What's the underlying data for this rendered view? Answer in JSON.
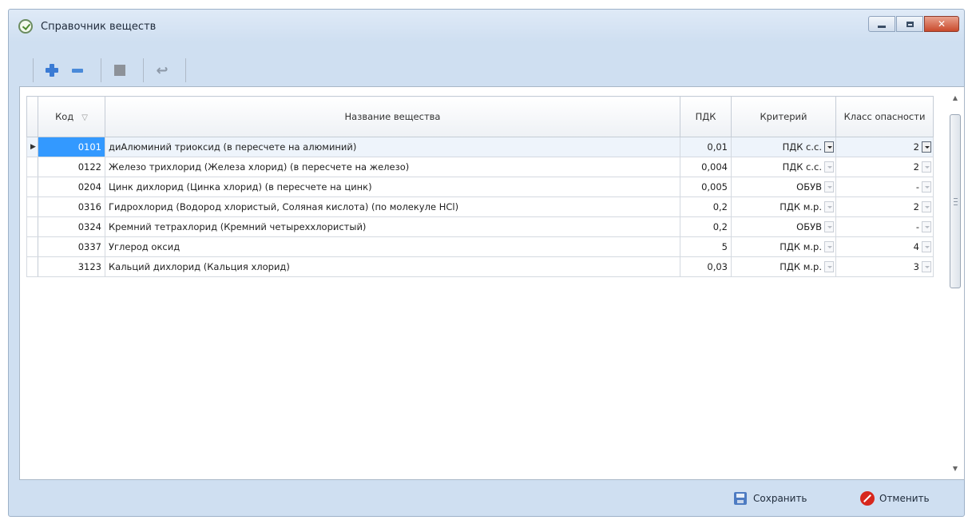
{
  "window": {
    "title": "Справочник веществ",
    "close_glyph": "✕"
  },
  "toolbar": {
    "icons": [
      "plus-icon",
      "minus-icon",
      "stop-icon",
      "undo-icon"
    ],
    "undo_glyph": "↩"
  },
  "grid": {
    "headers": {
      "code": "Код",
      "name": "Название вещества",
      "pdk": "ПДК",
      "criterion": "Критерий",
      "hazard_class": "Класс опасности"
    },
    "sort_indicator": "▽",
    "row_indicator": "▶",
    "rows": [
      {
        "code": "0101",
        "name": "диАлюминий триоксид (в пересчете на алюминий)",
        "pdk": "0,01",
        "criterion": "ПДК с.с.",
        "hazard_class": "2"
      },
      {
        "code": "0122",
        "name": "Железо трихлорид (Железа хлорид) (в пересчете на железо)",
        "pdk": "0,004",
        "criterion": "ПДК с.с.",
        "hazard_class": "2"
      },
      {
        "code": "0204",
        "name": "Цинк дихлорид (Цинка хлорид) (в пересчете на цинк)",
        "pdk": "0,005",
        "criterion": "ОБУВ",
        "hazard_class": "-"
      },
      {
        "code": "0316",
        "name": "Гидрохлорид (Водород хлористый, Соляная кислота) (по молекуле HCl)",
        "pdk": "0,2",
        "criterion": "ПДК м.р.",
        "hazard_class": "2"
      },
      {
        "code": "0324",
        "name": "Кремний тетрахлорид (Кремний четыреххлористый)",
        "pdk": "0,2",
        "criterion": "ОБУВ",
        "hazard_class": "-"
      },
      {
        "code": "0337",
        "name": "Углерод оксид",
        "pdk": "5",
        "criterion": "ПДК м.р.",
        "hazard_class": "4"
      },
      {
        "code": "3123",
        "name": "Кальций дихлорид (Кальция хлорид)",
        "pdk": "0,03",
        "criterion": "ПДК м.р.",
        "hazard_class": "3"
      }
    ]
  },
  "scrollbar": {
    "up": "▲",
    "down": "▼"
  },
  "actions": {
    "save_label": "Сохранить",
    "cancel_label": "Отменить"
  }
}
